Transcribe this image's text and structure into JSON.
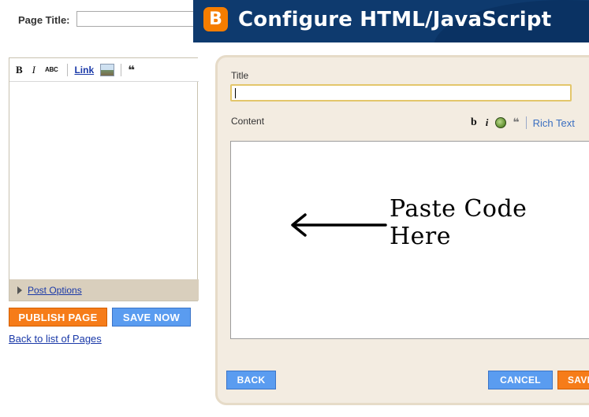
{
  "page_editor": {
    "title_label": "Page Title:",
    "title_value": "",
    "toolbar": {
      "bold": "B",
      "italic": "I",
      "spellcheck": "ABC",
      "link": "Link",
      "quote": "❝"
    },
    "post_options": "Post Options",
    "publish_button": "PUBLISH PAGE",
    "save_button": "SAVE NOW",
    "back_link": "Back to list of Pages"
  },
  "dialog": {
    "logo_letter": "B",
    "title": "Configure HTML/JavaScript",
    "title_field_label": "Title",
    "title_field_value": "",
    "content_label": "Content",
    "content_toolbar": {
      "bold": "b",
      "italic": "i",
      "quote": "❝",
      "rich_text": "Rich Text"
    },
    "annotation_text": "Paste Code Here",
    "back_button": "BACK",
    "cancel_button": "CANCEL",
    "save_button": "SAVE"
  },
  "colors": {
    "header_bg": "#0e3a6e",
    "panel_bg": "#f3ece1",
    "orange_button": "#f67c19",
    "blue_button": "#5a9cf0",
    "link": "#1a39a8"
  },
  "icons": [
    "blogger-logo-icon",
    "image-icon",
    "quote-icon",
    "globe-icon",
    "arrow-left-icon",
    "triangle-right-icon"
  ]
}
